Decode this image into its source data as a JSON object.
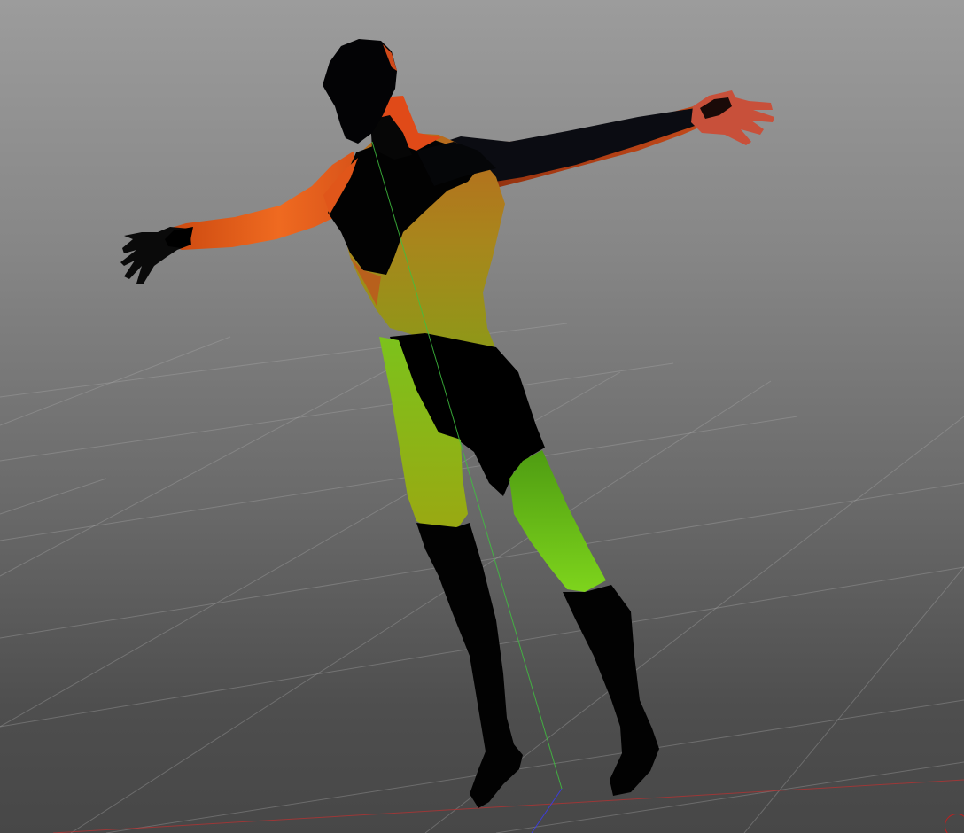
{
  "viewport": {
    "background_top": "#9c9c9c",
    "background_bottom": "#474747",
    "grid_color": "#b4b4b4",
    "y_axis_color": "#3fbf3f",
    "x_axis_color": "#c03030",
    "z_axis_color": "#3a3aff",
    "model": {
      "name": "",
      "weight_colors": {
        "zero": "#000000",
        "low": "#8a2c08",
        "mid": "#e0561a",
        "high_orange": "#c87420",
        "yellow": "#9a9e14",
        "green": "#7ec81a"
      }
    },
    "gizmo_icon": "view-orientation-gizmo"
  }
}
